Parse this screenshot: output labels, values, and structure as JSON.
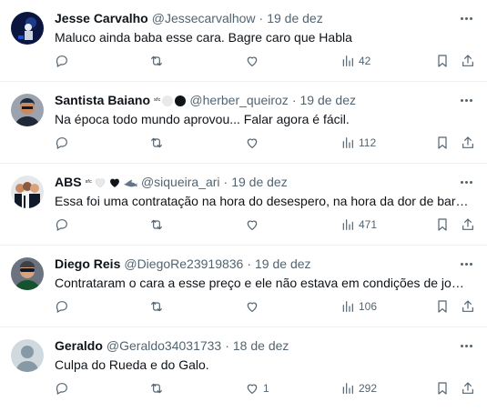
{
  "tweets": [
    {
      "name": "Jesse Carvalho",
      "emoji_text": "",
      "handle": "@Jessecarvalhow",
      "sep": "·",
      "time": "19 de dez",
      "text": "Maluco ainda baba esse cara. Bagre caro que Habla",
      "likes": "",
      "views": "42",
      "avatar_icon": "avatar-dark-blue"
    },
    {
      "name": "Santista Baiano",
      "emoji_text": "ˢᶠᶜ",
      "handle": "@herber_queiroz",
      "sep": "·",
      "time": "19 de dez",
      "text": "Na época todo mundo aprovou... Falar agora é fácil.",
      "likes": "",
      "views": "112",
      "avatar_icon": "avatar-man"
    },
    {
      "name": "ABS",
      "emoji_text": "ˢᶠᶜ",
      "handle": "@siqueira_ari",
      "sep": "·",
      "time": "19 de dez",
      "text": "Essa foi uma contratação na hora do desespero,  na hora da dor de barriga.",
      "likes": "",
      "views": "471",
      "avatar_icon": "avatar-group"
    },
    {
      "name": "Diego Reis",
      "emoji_text": "",
      "handle": "@DiegoRe23919836",
      "sep": "·",
      "time": "19 de dez",
      "text": "Contrataram o cara a esse preço e ele não estava em condições de jogo...",
      "likes": "",
      "views": "106",
      "avatar_icon": "avatar-man-sunglasses"
    },
    {
      "name": "Geraldo",
      "emoji_text": "",
      "handle": "@Geraldo34031733",
      "sep": "·",
      "time": "18 de dez",
      "text": "Culpa do Rueda e do Galo.",
      "likes": "1",
      "views": "292",
      "avatar_icon": "avatar-default"
    }
  ],
  "colors": {
    "text_primary": "#0f1419",
    "text_secondary": "#536471",
    "divider": "#eff3f4"
  }
}
